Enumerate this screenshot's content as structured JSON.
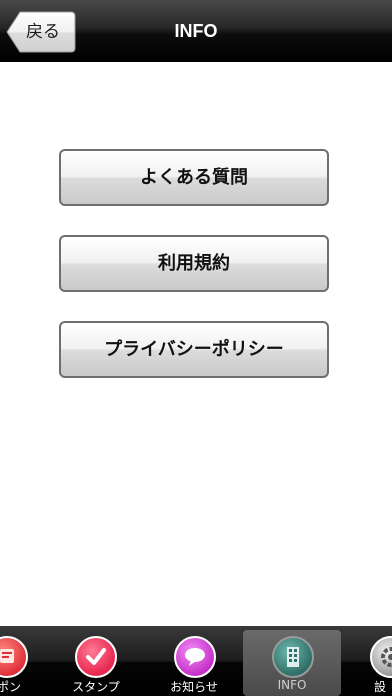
{
  "navbar": {
    "back_label": "戻る",
    "title": "INFO"
  },
  "menu": {
    "items": [
      {
        "label": "よくある質問"
      },
      {
        "label": "利用規約"
      },
      {
        "label": "プライバシーポリシー"
      }
    ]
  },
  "tabbar": {
    "items": [
      {
        "label": "ポン",
        "icon": "coupon-icon",
        "color": "#e0303a"
      },
      {
        "label": "スタンプ",
        "icon": "stamp-icon",
        "color": "#e8264f"
      },
      {
        "label": "お知らせ",
        "icon": "notice-icon",
        "color": "#c531c9"
      },
      {
        "label": "INFO",
        "icon": "building-icon",
        "color": "#2f8a80",
        "selected": true
      },
      {
        "label": "設",
        "icon": "settings-icon",
        "color": "#bdbdbd"
      }
    ]
  }
}
